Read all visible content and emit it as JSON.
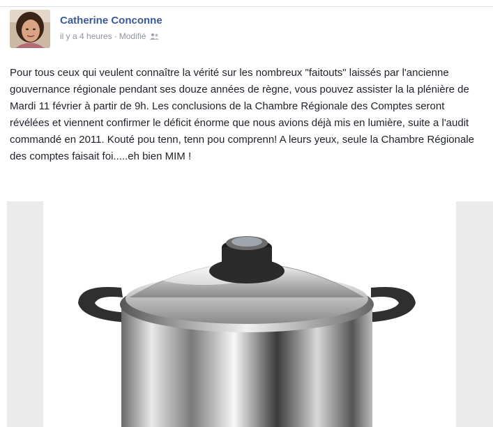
{
  "post": {
    "author": "Catherine Conconne",
    "time": "il y a 4 heures",
    "separator": "·",
    "edited": "Modifié",
    "audience_icon": "friends-icon",
    "text": "Pour tous ceux qui veulent connaître la vérité sur les nombreux \"faitouts\" laissés par l'ancienne gouvernance régionale pendant ses douze années de règne, vous pouvez assister la la plénière de Mardi 11 février à partir de 9h. Les conclusions de la Chambre Régionale des Comptes seront révélées et viennent confirmer le déficit énorme que nous avions déjà mis en lumière, suite a l'audit commandé en 2011. Kouté pou tenn, tenn pou comprenn! A leurs yeux, seule la Chambre Régionale des comptes faisait foi.....eh bien MIM !",
    "photo": "stockpot-photo"
  },
  "colors": {
    "author": "#3b5998",
    "meta": "#90949c",
    "text": "#1d2129",
    "photo_band": "#ebebeb"
  }
}
